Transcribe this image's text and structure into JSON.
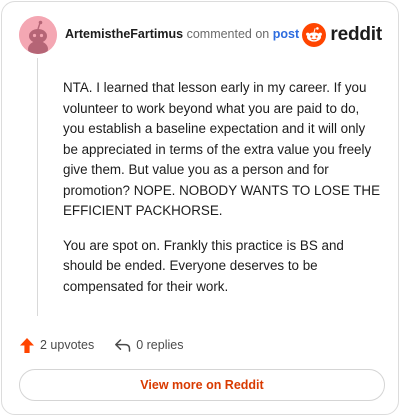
{
  "comment": {
    "username": "ArtemistheFartimus",
    "action_text": "commented on",
    "post_link": "post",
    "brand": "reddit",
    "paragraphs": [
      "NTA. I learned that lesson early in my career. If you volunteer to work beyond what you are paid to do, you establish a baseline expectation and it will only be appreciated in terms of the extra value you freely give them. But value you as a person and for promotion? NOPE. NOBODY WANTS TO LOSE THE EFFICIENT PACKHORSE.",
      "You are spot on. Frankly this practice is BS and should be ended. Everyone deserves to be compensated for their work."
    ]
  },
  "actions": {
    "upvotes": "2 upvotes",
    "replies": "0 replies"
  },
  "view_more_label": "View more on Reddit",
  "colors": {
    "accent": "#ff4500",
    "link": "#2d6cdf",
    "avatar_bg": "#f4a7b3"
  }
}
